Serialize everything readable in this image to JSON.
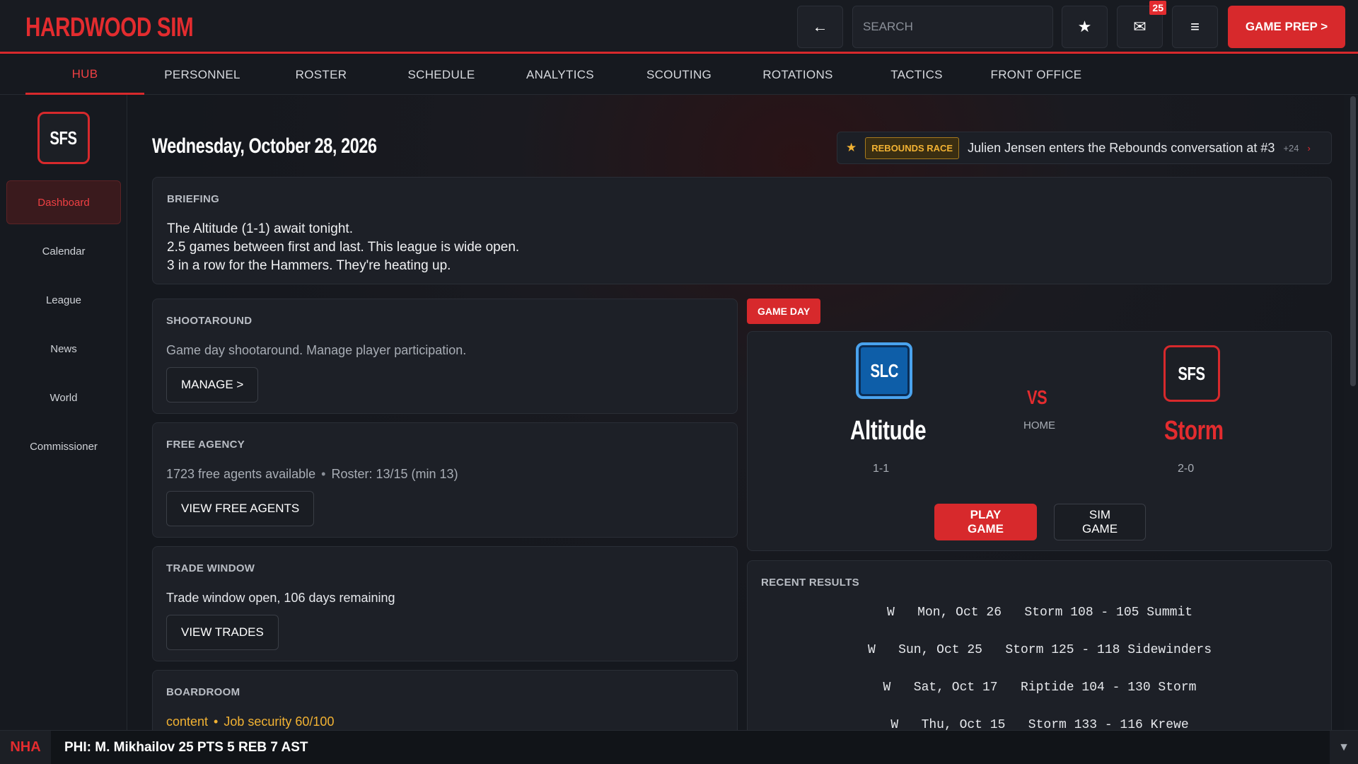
{
  "app": {
    "title": "HARDWOOD SIM"
  },
  "header": {
    "back_label": "←",
    "search_placeholder": "SEARCH",
    "star_label": "★",
    "mail_label": "✉",
    "mail_count": "25",
    "menu_label": "≡",
    "game_prep_label": "GAME PREP >"
  },
  "nav": {
    "tabs": [
      {
        "label": "HUB",
        "active": true
      },
      {
        "label": "PERSONNEL"
      },
      {
        "label": "ROSTER"
      },
      {
        "label": "SCHEDULE"
      },
      {
        "label": "ANALYTICS"
      },
      {
        "label": "SCOUTING"
      },
      {
        "label": "ROTATIONS"
      },
      {
        "label": "TACTICS"
      },
      {
        "label": "FRONT OFFICE"
      }
    ]
  },
  "sidebar": {
    "team_abbr": "SFS",
    "items": [
      {
        "label": "Dashboard",
        "active": true
      },
      {
        "label": "Calendar"
      },
      {
        "label": "League"
      },
      {
        "label": "News"
      },
      {
        "label": "World"
      },
      {
        "label": "Commissioner"
      }
    ]
  },
  "main": {
    "date": "Wednesday, October 28, 2026",
    "ticker": {
      "tag": "REBOUNDS RACE",
      "text": "Julien Jensen enters the Rebounds conversation at #3",
      "count": "+24",
      "arrow": "›"
    },
    "briefing": {
      "title": "BRIEFING",
      "lines": [
        "The Altitude (1-1) await tonight.",
        "2.5 games between first and last. This league is wide open.",
        "3 in a row for the Hammers. They're heating up."
      ]
    },
    "shootaround": {
      "title": "SHOOTAROUND",
      "text": "Game day shootaround. Manage player participation.",
      "button": "MANAGE >"
    },
    "free_agency": {
      "title": "FREE AGENCY",
      "available": "1723 free agents available",
      "roster": "Roster: 13/15 (min 13)",
      "button": "VIEW FREE AGENTS"
    },
    "trade_window": {
      "title": "TRADE WINDOW",
      "text": "Trade window open, 106 days remaining",
      "button": "VIEW TRADES"
    },
    "boardroom": {
      "title": "BOARDROOM",
      "mood": "content",
      "security": "Job security 60/100"
    },
    "game_day": {
      "tag": "GAME DAY",
      "away": {
        "abbr": "SLC",
        "name": "Altitude",
        "record": "1-1"
      },
      "vs": "VS",
      "home_label": "HOME",
      "home": {
        "abbr": "SFS",
        "name": "Storm",
        "record": "2-0"
      },
      "play_label": "PLAY GAME",
      "sim_label": "SIM GAME"
    },
    "recent_results": {
      "title": "RECENT RESULTS",
      "rows": [
        {
          "result": "W",
          "date": "Mon, Oct 26",
          "score": "Storm 108 - 105 Summit"
        },
        {
          "result": "W",
          "date": "Sun, Oct 25",
          "score": "Storm 125 - 118 Sidewinders"
        },
        {
          "result": "W",
          "date": "Sat, Oct 17",
          "score": "Riptide 104 - 130 Storm"
        },
        {
          "result": "W",
          "date": "Thu, Oct 15",
          "score": "Storm 133 - 116 Krewe"
        }
      ]
    }
  },
  "bottom": {
    "league": "NHA",
    "ticker": "PHI: M. Mikhailov 25 PTS 5 REB 7 AST",
    "caret": "▼"
  },
  "colors": {
    "accent": "#d7292c",
    "gold": "#f2b233",
    "away_team": "#0e5ea8",
    "background": "#14171d"
  }
}
